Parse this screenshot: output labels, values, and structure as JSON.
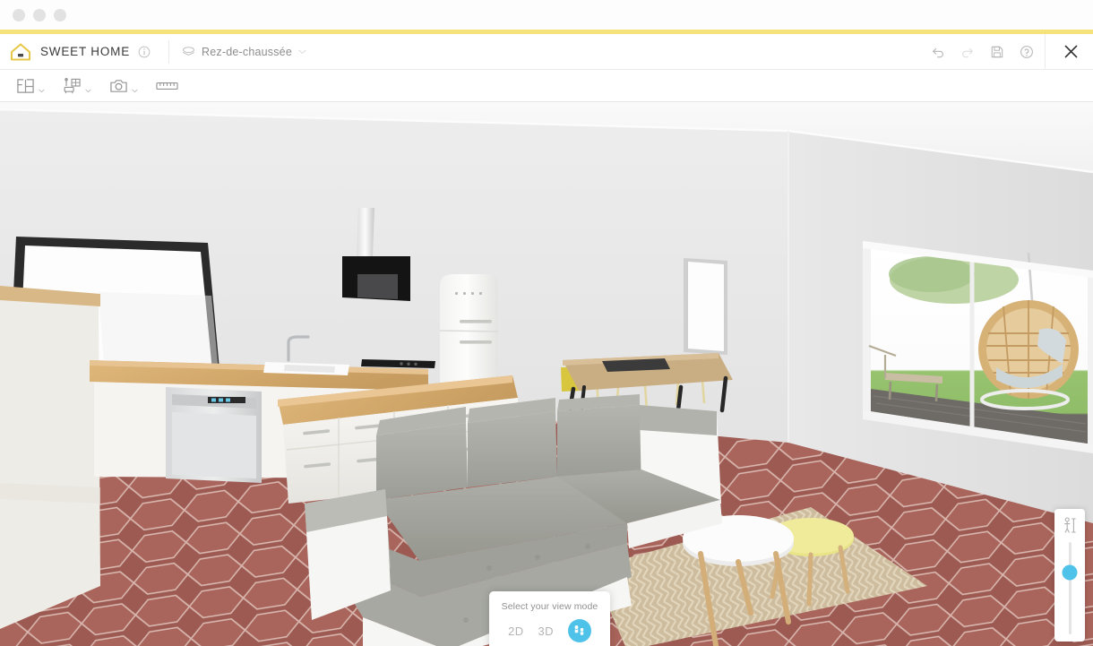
{
  "window": {
    "controls": [
      "close",
      "minimize",
      "maximize"
    ],
    "accent_color": "#f5e27a"
  },
  "header": {
    "brand_name": "SWEET HOME",
    "logo_icon": "house-icon",
    "info_icon": "info-icon",
    "floor_selector": {
      "label": "Rez-de-chaussée",
      "icon": "layers-icon",
      "chevron": "chevron-down-icon"
    },
    "actions": [
      {
        "name": "undo",
        "icon": "undo-icon",
        "enabled": true
      },
      {
        "name": "redo",
        "icon": "redo-icon",
        "enabled": false
      },
      {
        "name": "save",
        "icon": "save-floppy-icon",
        "enabled": true
      },
      {
        "name": "help",
        "icon": "help-circle-icon",
        "enabled": true
      }
    ],
    "close_icon": "close-icon"
  },
  "toolbar": {
    "tools": [
      {
        "name": "floor-plan",
        "icon": "floorplan-icon",
        "has_dropdown": true
      },
      {
        "name": "furniture",
        "icon": "furniture-icon",
        "has_dropdown": true
      },
      {
        "name": "photo",
        "icon": "camera-icon",
        "has_dropdown": true
      },
      {
        "name": "measure",
        "icon": "ruler-icon",
        "has_dropdown": false
      }
    ]
  },
  "viewport": {
    "scene_name": "living-room-kitchen-3d-view",
    "view_mode": "first-person",
    "colors": {
      "floor_tile": "#9c5a52",
      "grout": "#d8b6ad",
      "wall": "#ebebeb",
      "ceiling": "#f4f4f4",
      "countertop_wood": "#d5a96d",
      "cabinet_white": "#f4f2ee",
      "sofa_fabric": "#a9aaa4",
      "sofa_base": "#f6f6f4",
      "rug": "#cdbb9c",
      "chair_yellow": "#e3d14a",
      "table_yellow": "#e6e27e",
      "grass": "#8fbe6b",
      "deck": "#6f6a66",
      "hood_black": "#1c1c1c",
      "rattan": "#d2ae74"
    },
    "objects": [
      "black-framed-window",
      "tall-white-cabinet",
      "kitchen-counter-wood",
      "dishwasher",
      "sink-with-faucet",
      "induction-cooktop",
      "range-hood",
      "retro-refrigerator",
      "kitchen-island",
      "dining-table",
      "yellow-dining-chairs",
      "back-wall-window",
      "sliding-glass-doors",
      "hanging-egg-chair",
      "garden-bench",
      "tree",
      "sectional-sofa",
      "white-round-table",
      "yellow-round-table",
      "herringbone-rug"
    ]
  },
  "view_mode_panel": {
    "title": "Select your view mode",
    "options": [
      {
        "label": "2D",
        "name": "view-mode-2d",
        "active": false
      },
      {
        "label": "3D",
        "name": "view-mode-3d",
        "active": false
      },
      {
        "label": "",
        "name": "view-mode-first-person",
        "active": true,
        "icon": "footsteps-icon"
      }
    ],
    "active_color": "#4fc2e9"
  },
  "height_slider": {
    "name": "camera-height-slider",
    "icon": "person-height-icon",
    "handle_color": "#4fc2e9",
    "value_percent": 67
  }
}
